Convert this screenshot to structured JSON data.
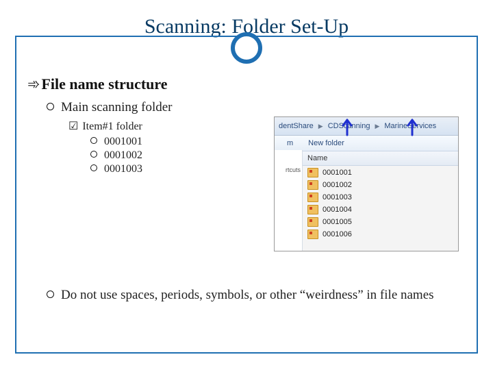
{
  "title": "Scanning: Folder Set-Up",
  "lvl1": "File name structure",
  "lvl2a": "Main scanning folder",
  "lvl3": "Item#1 folder",
  "lvl4": [
    "0001001",
    "0001002",
    "0001003"
  ],
  "note": "Do not use spaces, periods, symbols, or other “weirdness” in file names",
  "shot": {
    "crumb1": "dentShare",
    "crumb2": "CDScanning",
    "crumb3": "MarineServices",
    "menu_m": "m",
    "menu_new": "New folder",
    "col_name": "Name",
    "left_label": "rtcuts",
    "files": [
      "0001001",
      "0001002",
      "0001003",
      "0001004",
      "0001005",
      "0001006"
    ]
  }
}
